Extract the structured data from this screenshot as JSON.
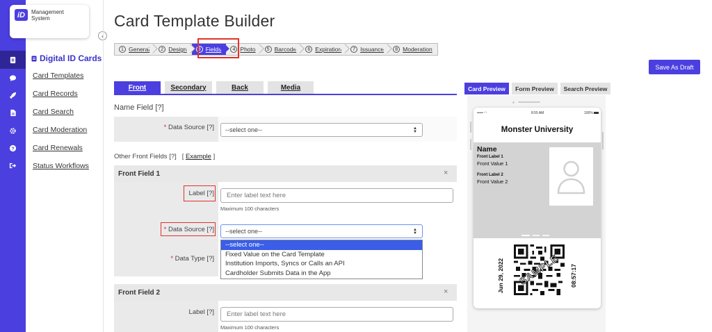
{
  "logo": {
    "badge": "iD",
    "line1": "Management",
    "line2": "System"
  },
  "rail": {
    "icons": [
      "id-card-icon",
      "chat-icon",
      "rocket-icon",
      "document-icon",
      "gear-icon",
      "help-icon",
      "logout-icon"
    ]
  },
  "menu": {
    "title": "Digital ID Cards",
    "items": [
      "Card Templates",
      "Card Records",
      "Card Search",
      "Card Moderation",
      "Card Renewals",
      "Status Workflows"
    ]
  },
  "page": {
    "title": "Card Template Builder"
  },
  "steps": [
    {
      "num": "1",
      "label": "General"
    },
    {
      "num": "2",
      "label": "Design"
    },
    {
      "num": "3",
      "label": "Fields",
      "active": true
    },
    {
      "num": "4",
      "label": "Photo"
    },
    {
      "num": "5",
      "label": "Barcode"
    },
    {
      "num": "6",
      "label": "Expiration"
    },
    {
      "num": "7",
      "label": "Issuance"
    },
    {
      "num": "8",
      "label": "Moderation"
    }
  ],
  "actions": {
    "save_draft": "Save As Draft"
  },
  "tabs": {
    "front": "Front",
    "secondary": "Secondary",
    "back": "Back",
    "media": "Media"
  },
  "name_field": {
    "title": "Name Field",
    "help": "[?]",
    "data_source_label": "Data Source [?]",
    "data_source_value": "--select one--"
  },
  "other_fields": {
    "label": "Other Front Fields [?]",
    "example_open": "[",
    "example": "Example",
    "example_close": "]"
  },
  "front_field_1": {
    "title": "Front Field 1",
    "label_label": "Label [?]",
    "label_placeholder": "Enter label text here",
    "label_hint": "Maximum 100 characters",
    "data_source_label": "Data Source [?]",
    "data_source_value": "--select one--",
    "data_type_label": "Data Type [?]"
  },
  "dropdown_options": [
    "--select one--",
    "Fixed Value on the Card Template",
    "Institution Imports, Syncs or Calls an API",
    "Cardholder Submits Data in the App"
  ],
  "front_field_2": {
    "title": "Front Field 2",
    "label_label": "Label [?]",
    "label_placeholder": "Enter label text here",
    "label_hint": "Maximum 100 characters"
  },
  "required_mark": "*",
  "close_glyph": "×",
  "preview_tabs": {
    "card": "Card Preview",
    "form": "Form Preview",
    "search": "Search Preview"
  },
  "phone": {
    "status_left": "••••• ",
    "status_time": "8:55 AM",
    "status_right": "100%",
    "university": "Monster University",
    "name": "Name",
    "label1": "Front Label 1",
    "value1": "Front Value 1",
    "label2": "Front Label 2",
    "value2": "Front Value 2",
    "date": "Jun 29, 2022",
    "time": "08:57:17",
    "watermark": "SAMPLE"
  },
  "colors": {
    "brand": "#4b3fe0",
    "highlight": "#e0322a",
    "required": "#d7262e"
  }
}
